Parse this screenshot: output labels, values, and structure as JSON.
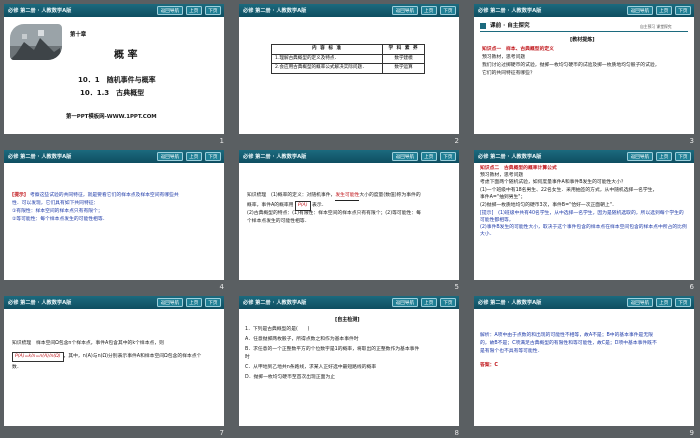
{
  "header": {
    "title": "必修 第二册 · 人教数学A版",
    "back_label": "返回导航",
    "prev_label": "上页",
    "next_label": "下页"
  },
  "slides": [
    {
      "number": "1",
      "chapter": "第十章",
      "title": "概 率",
      "section1": "10．1　随机事件与概率",
      "section2": "10．1.3　古典概型",
      "footer": "第一PPT模板网-WWW.1PPT.COM"
    },
    {
      "number": "2",
      "table_headers": [
        "内 容 标 准",
        "学 科 素 养"
      ],
      "rows": [
        [
          "1.理解古典概型的定义及特点．",
          "数学建模"
        ],
        [
          "2.会应用古典概型的概率公式解决实际问题．",
          "数学运算"
        ]
      ]
    },
    {
      "number": "3",
      "banner": "课前 · 自主探究",
      "banner_tabs": "自主预习  课堂探究",
      "tag": "[教材提炼]",
      "lines": [
        "知识点一　样本、古典概型的定义",
        "预习教材，思考问题",
        "我们讨论过掷硬币的试验，抛掷一枚均匀硬币的试验及掷一枚质地均匀骰子的试验，",
        "它们的共同特征有哪些？"
      ]
    },
    {
      "number": "4",
      "tag": "[提示]",
      "lines": [
        "考察这些试验的共同特征，就是要看它们的样本点及样本空间有哪些共",
        "性．可以发现，它们具有如下共同特征：",
        "①有限性：样本空间的样本点只有有限个；",
        "②等可能性：每个样本点发生的可能性相等．"
      ]
    },
    {
      "number": "5",
      "lines": [
        "知识梳理　(1)概率的定义：对随机事件，",
        "大小的度量(数值)称为事件的",
        "概率，事件A的概率用",
        "表示．",
        "(2)古典概型的特点：(1)有限性：样本空间的样本点只有有限个；(2)等可能性：每",
        "个样本点发生的可能性相等．"
      ],
      "highlight": "发生可能性",
      "formula": "P(A)"
    },
    {
      "number": "6",
      "lines": [
        "知识点二　古典概型的概率计算公式",
        "预习教材，思考问题",
        "考虑下面两个随机试验，如何度量事件A和事件B发生的可能性大小？",
        "(1)一个班级中有18名男生、22名女生．采用抽签的方式，从中随机选择一名学生，",
        "事件A=\"抽到男生\"；",
        "(2)抛掷一枚质地均匀的硬币3次，事件B=\"恰好一次正面朝上\"．",
        "[提示]　(1)班级中共有40名学生，从中选择一名学生，因为是随机选取的，所以选到每个学生的可能性都相等，",
        "(2)事件B发生的可能性大小，取决于这个事件包含的样本点在样本空间包含的样本点中所占的比例大小．"
      ]
    },
    {
      "number": "7",
      "lines": [
        "知识梳理　样本空间Ω包含n个样本点，事件A包含其中的k个样本点，则",
        "，其中，n(A)与n(Ω)分别表示事件A和样本空间Ω包含的样本点个",
        "数．"
      ],
      "formula": "P(A)=k/n=n(A)/n(Ω)"
    },
    {
      "number": "8",
      "tag": "[自主检测]",
      "lines": [
        "1．下列是古典概型的是(　　)",
        "A．任意抛掷两枚骰子，所得点数之和作为基本事件时",
        "B．求任意的一个正整数平方的个位数字是1的概率，将取出的正整数作为基本事件",
        "时",
        "C．从甲地到乙地共n条路线，求某人正好选中最短路线的概率",
        "D．抛掷一枚均匀硬币至首次出现正面为止"
      ]
    },
    {
      "number": "9",
      "lines": [
        "解析：A项中由于点数的和出现的可能性不相等，故A不是；B中的基本事件是无限",
        "的，故B不是；C项满足古典概型的有限性和等可能性，故C是；D项中基本事件既不",
        "是有限个也不具有等可能性．",
        "答案：C"
      ]
    }
  ]
}
